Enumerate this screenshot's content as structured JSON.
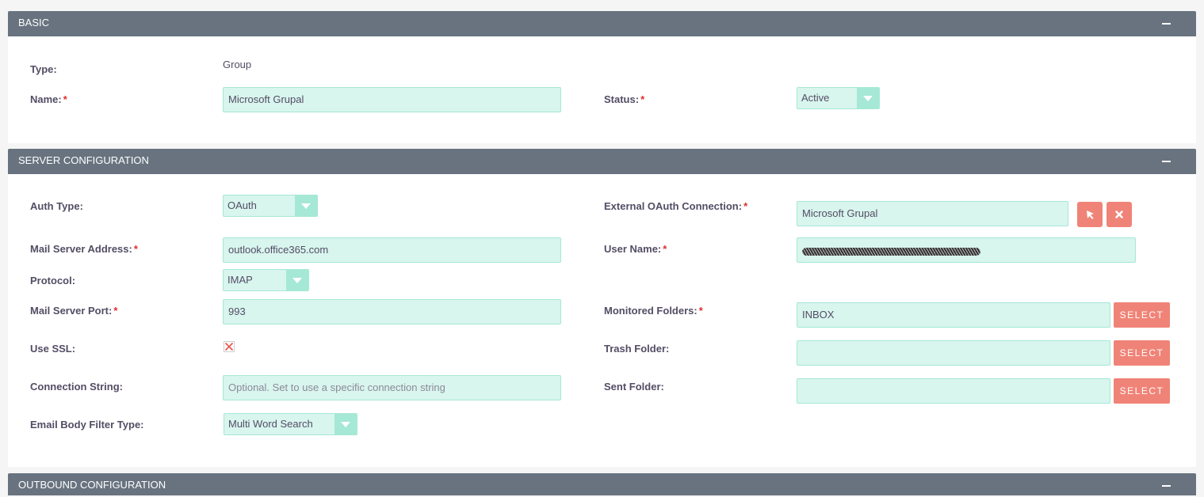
{
  "panels": {
    "basic": {
      "title": "BASIC"
    },
    "server": {
      "title": "SERVER CONFIGURATION"
    },
    "outbound": {
      "title": "OUTBOUND CONFIGURATION"
    }
  },
  "basic": {
    "type_label": "Type:",
    "type_value": "Group",
    "name_label": "Name:",
    "name_value": "Microsoft Grupal",
    "status_label": "Status:",
    "status_value": "Active"
  },
  "server": {
    "auth_type_label": "Auth Type:",
    "auth_type_value": "OAuth",
    "ext_oauth_label": "External OAuth Connection:",
    "ext_oauth_value": "Microsoft Grupal",
    "mail_server_label": "Mail Server Address:",
    "mail_server_value": "outlook.office365.com",
    "user_name_label": "User Name:",
    "protocol_label": "Protocol:",
    "protocol_value": "IMAP",
    "port_label": "Mail Server Port:",
    "port_value": "993",
    "monitored_label": "Monitored Folders:",
    "monitored_value": "INBOX",
    "ssl_label": "Use SSL:",
    "trash_label": "Trash Folder:",
    "trash_value": "",
    "conn_label": "Connection String:",
    "conn_placeholder": "Optional. Set to use a specific connection string",
    "sent_label": "Sent Folder:",
    "sent_value": "",
    "filter_label": "Email Body Filter Type:",
    "filter_value": "Multi Word Search",
    "select_button": "SELECT"
  },
  "required_mark": "*",
  "icons": {
    "collapse": "minus-icon",
    "select_cursor": "cursor-arrow-icon",
    "clear": "close-icon",
    "ssl": "x-mark-icon"
  },
  "colors": {
    "header_bg": "#68737f",
    "input_bg": "#d8f5ee",
    "input_border": "#a5e8d6",
    "button_bg": "#f08377",
    "required": "#e02e2e"
  }
}
